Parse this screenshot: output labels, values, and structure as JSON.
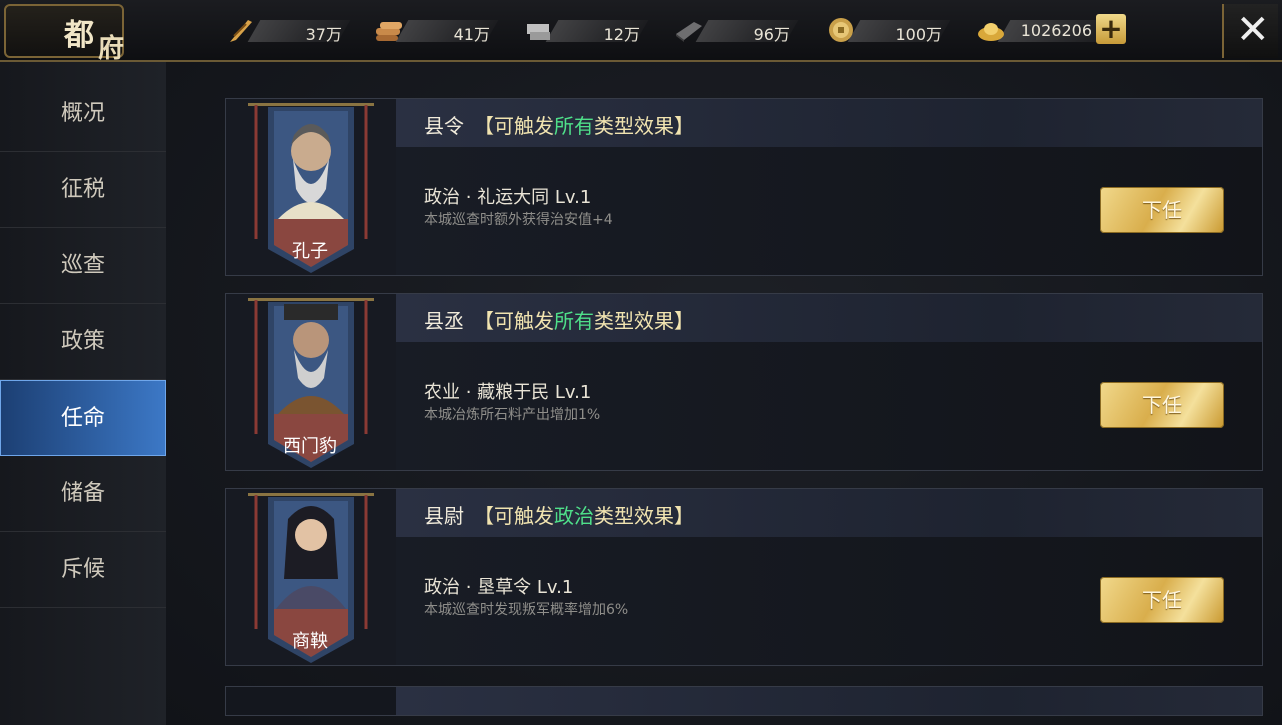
{
  "window": {
    "title_1": "都",
    "title_2": "府",
    "close_label": "✕",
    "add_label": "+"
  },
  "resources": [
    {
      "icon": "feather-icon",
      "value": "37万"
    },
    {
      "icon": "wood-icon",
      "value": "41万"
    },
    {
      "icon": "stone-icon",
      "value": "12万"
    },
    {
      "icon": "iron-icon",
      "value": "96万"
    },
    {
      "icon": "coin-icon",
      "value": "100万"
    },
    {
      "icon": "gold-ingot-icon",
      "value": "1026206"
    }
  ],
  "sidebar": {
    "items": [
      {
        "label": "概况"
      },
      {
        "label": "征税"
      },
      {
        "label": "巡查"
      },
      {
        "label": "政策"
      },
      {
        "label": "任命",
        "active": true
      },
      {
        "label": "储备"
      },
      {
        "label": "斥候"
      }
    ]
  },
  "appointments": [
    {
      "role": "县令",
      "effect_prefix": "【可触发",
      "effect_highlight": "所有",
      "effect_suffix": "类型效果】",
      "skill": "政治 · 礼运大同  Lv.1",
      "description": "本城巡查时额外获得治安值+4",
      "name": "孔子",
      "button": "下任"
    },
    {
      "role": "县丞",
      "effect_prefix": "【可触发",
      "effect_highlight": "所有",
      "effect_suffix": "类型效果】",
      "skill": "农业 · 藏粮于民  Lv.1",
      "description": "本城冶炼所石料产出增加1%",
      "name": "西门豹",
      "button": "下任"
    },
    {
      "role": "县尉",
      "effect_prefix": "【可触发",
      "effect_highlight": "政治",
      "effect_suffix": "类型效果】",
      "skill": "政治 · 垦草令  Lv.1",
      "description": "本城巡查时发现叛军概率增加6%",
      "name": "商鞅",
      "button": "下任"
    }
  ],
  "colors": {
    "accent_gold": "#d9ae4c",
    "highlight_green": "#4fe08a",
    "active_tab": "#3c78c6"
  }
}
